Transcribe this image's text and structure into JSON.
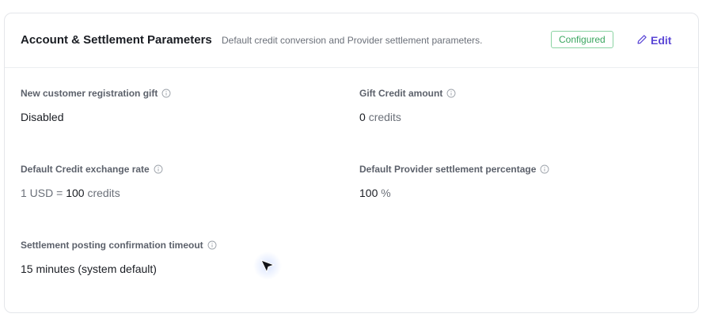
{
  "header": {
    "title": "Account & Settlement Parameters",
    "subtitle": "Default credit conversion and Provider settlement parameters.",
    "status_badge": "Configured",
    "edit_label": "Edit"
  },
  "fields": {
    "registration_gift": {
      "label": "New customer registration gift",
      "value": "Disabled"
    },
    "gift_credit_amount": {
      "label": "Gift Credit amount",
      "value": "0",
      "unit": "credits"
    },
    "exchange_rate": {
      "label": "Default Credit exchange rate",
      "prefix": "1 USD =",
      "value": "100",
      "unit": "credits"
    },
    "provider_settlement": {
      "label": "Default Provider settlement percentage",
      "value": "100",
      "unit": "%"
    },
    "posting_timeout": {
      "label": "Settlement posting confirmation timeout",
      "value": "15 minutes (system default)"
    }
  },
  "icons": {
    "info": "info-circle-icon",
    "edit": "pencil-icon",
    "cursor": "mouse-pointer-icon"
  },
  "colors": {
    "accent": "#5b47d6",
    "success": "#3aa65f",
    "success_border": "#8ad3a2"
  }
}
